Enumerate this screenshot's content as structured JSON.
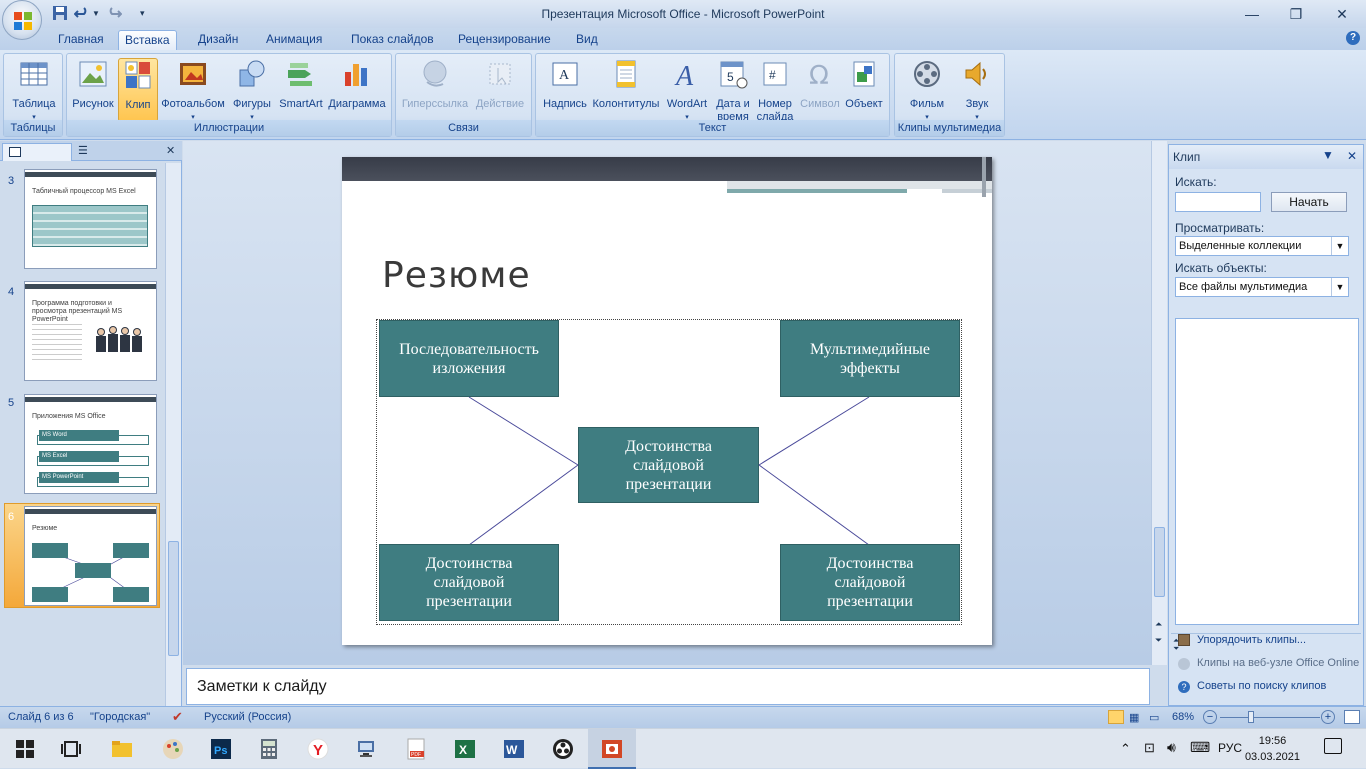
{
  "window": {
    "title": "Презентация Microsoft Office - Microsoft PowerPoint"
  },
  "tabs": [
    "Главная",
    "Вставка",
    "Дизайн",
    "Анимация",
    "Показ слайдов",
    "Рецензирование",
    "Вид"
  ],
  "active_tab": "Вставка",
  "ribbon": {
    "groups": {
      "tables": "Таблицы",
      "illustrations": "Иллюстрации",
      "links": "Связи",
      "text": "Текст",
      "media": "Клипы мультимедиа"
    },
    "buttons": {
      "table": "Таблица",
      "picture": "Рисунок",
      "clip": "Клип",
      "photoalbum": "Фотоальбом",
      "shapes": "Фигуры",
      "smartart": "SmartArt",
      "chart": "Диаграмма",
      "hyperlink": "Гиперссылка",
      "action": "Действие",
      "textbox": "Надпись",
      "header_footer": "Колонтитулы",
      "wordart": "WordArt",
      "datetime_1": "Дата и",
      "datetime_2": "время",
      "slide_number_1": "Номер",
      "slide_number_2": "слайда",
      "symbol": "Символ",
      "object": "Объект",
      "movie": "Фильм",
      "sound": "Звук"
    }
  },
  "thumbnails": {
    "items": [
      {
        "num": "3",
        "title": "Табличный процессор MS Excel"
      },
      {
        "num": "4",
        "title": "Программа подготовки и просмотра презентаций MS PowerPoint"
      },
      {
        "num": "5",
        "title": "Приложения MS Office",
        "rows": [
          "MS Word",
          "MS Excel",
          "MS PowerPoint"
        ]
      },
      {
        "num": "6",
        "title": "Резюме"
      }
    ]
  },
  "slide": {
    "title": "Резюме",
    "boxes": {
      "top_left": "Последовательность изложения",
      "top_right": "Мультимедийные эффекты",
      "center": "Достоинства слайдовой презентации",
      "bottom_left": "Достоинства слайдовой презентации",
      "bottom_right": "Достоинства слайдовой презентации"
    }
  },
  "notes": {
    "placeholder": "Заметки к слайду"
  },
  "taskpane": {
    "title": "Клип",
    "search_label": "Искать:",
    "search_value": "",
    "search_button": "Начать",
    "browse_label": "Просматривать:",
    "browse_value": "Выделенные коллекции",
    "objects_label": "Искать объекты:",
    "objects_value": "Все файлы мультимедиа",
    "link_organize": "Упорядочить клипы...",
    "link_online": "Клипы на веб-узле Office Online",
    "link_tips": "Советы по поиску клипов"
  },
  "statusbar": {
    "slide": "Слайд 6 из 6",
    "theme": "\"Городская\"",
    "language": "Русский (Россия)",
    "zoom": "68%"
  },
  "taskbar": {
    "lang": "РУС",
    "time": "19:56",
    "date": "03.03.2021"
  },
  "colors": {
    "box_fill": "#3f7d81",
    "ribbon_bg": "#c9daf0",
    "selected_button": "#ffc54f"
  }
}
